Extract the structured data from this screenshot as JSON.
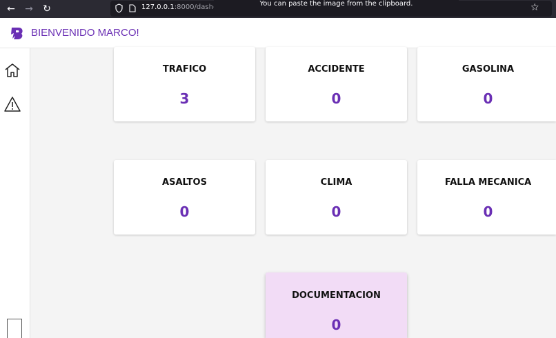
{
  "browser": {
    "url_host": "127.0.0.1",
    "url_rest": ":8000/dash-",
    "toast": "You can paste the image from the clipboard."
  },
  "header": {
    "welcome": "BIENVENIDO MARCO!"
  },
  "colors": {
    "accent": "#6a2fb4",
    "highlight_card": "#f2dcf6"
  },
  "sidebar": {
    "items": [
      {
        "icon": "home-icon"
      },
      {
        "icon": "warning-icon"
      }
    ]
  },
  "cards": [
    {
      "title": "TRAFICO",
      "value": "3"
    },
    {
      "title": "ACCIDENTE",
      "value": "0"
    },
    {
      "title": "GASOLINA",
      "value": "0"
    },
    {
      "title": "ASALTOS",
      "value": "0"
    },
    {
      "title": "CLIMA",
      "value": "0"
    },
    {
      "title": "FALLA MECANICA",
      "value": "0"
    },
    {
      "title": "DOCUMENTACION",
      "value": "0"
    }
  ]
}
